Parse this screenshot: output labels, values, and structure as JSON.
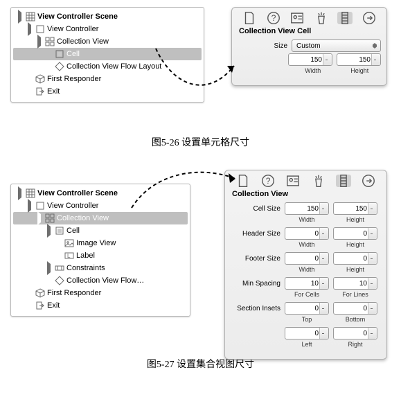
{
  "fig1": {
    "caption": "图5-26   设置单元格尺寸",
    "outline": {
      "rows": [
        {
          "depth": 0,
          "tri": true,
          "icon": "scene",
          "label": "View Controller Scene",
          "bold": true
        },
        {
          "depth": 1,
          "tri": true,
          "icon": "vc",
          "label": "View Controller"
        },
        {
          "depth": 2,
          "tri": true,
          "icon": "collection",
          "label": "Collection View"
        },
        {
          "depth": 3,
          "tri": false,
          "notri": true,
          "icon": "cell",
          "label": "Cell",
          "selected": true
        },
        {
          "depth": 3,
          "tri": false,
          "notri": true,
          "icon": "flow",
          "label": "Collection View Flow Layout"
        },
        {
          "depth": 1,
          "tri": false,
          "notri": true,
          "icon": "cube",
          "label": "First Responder"
        },
        {
          "depth": 1,
          "tri": false,
          "notri": true,
          "icon": "exit",
          "label": "Exit"
        }
      ]
    },
    "inspector": {
      "tabs": [
        "file",
        "help",
        "identity",
        "attrs",
        "size",
        "connections"
      ],
      "activeTab": 4,
      "title": "Collection View Cell",
      "sizeLabel": "Size",
      "sizeValue": "Custom",
      "width": "150",
      "height": "150",
      "widthLabel": "Width",
      "heightLabel": "Height"
    }
  },
  "fig2": {
    "caption": "图5-27   设置集合视图尺寸",
    "outline": {
      "rows": [
        {
          "depth": 0,
          "tri": true,
          "icon": "scene",
          "label": "View Controller Scene",
          "bold": true
        },
        {
          "depth": 1,
          "tri": true,
          "icon": "vc",
          "label": "View Controller"
        },
        {
          "depth": 2,
          "tri": true,
          "icon": "collection",
          "label": "Collection View",
          "selected": true
        },
        {
          "depth": 3,
          "tri": true,
          "icon": "cell",
          "label": "Cell"
        },
        {
          "depth": 4,
          "tri": false,
          "notri": true,
          "icon": "image",
          "label": "Image View"
        },
        {
          "depth": 4,
          "tri": false,
          "notri": true,
          "icon": "label",
          "label": "Label"
        },
        {
          "depth": 3,
          "tri": true,
          "closed": true,
          "icon": "constraints",
          "label": "Constraints"
        },
        {
          "depth": 3,
          "tri": false,
          "notri": true,
          "icon": "flow",
          "label": "Collection View Flow…"
        },
        {
          "depth": 1,
          "tri": false,
          "notri": true,
          "icon": "cube",
          "label": "First Responder"
        },
        {
          "depth": 1,
          "tri": false,
          "notri": true,
          "icon": "exit",
          "label": "Exit"
        }
      ]
    },
    "inspector": {
      "tabs": [
        "file",
        "help",
        "identity",
        "attrs",
        "size",
        "connections"
      ],
      "activeTab": 4,
      "title": "Collection View",
      "groups": [
        {
          "label": "Cell Size",
          "a": "150",
          "b": "150",
          "la": "Width",
          "lb": "Height"
        },
        {
          "label": "Header Size",
          "a": "0",
          "b": "0",
          "la": "Width",
          "lb": "Height"
        },
        {
          "label": "Footer Size",
          "a": "0",
          "b": "0",
          "la": "Width",
          "lb": "Height"
        },
        {
          "label": "Min Spacing",
          "a": "10",
          "b": "10",
          "la": "For Cells",
          "lb": "For Lines"
        },
        {
          "label": "Section Insets",
          "a": "0",
          "b": "0",
          "la": "Top",
          "lb": "Bottom"
        },
        {
          "label": "",
          "a": "0",
          "b": "0",
          "la": "Left",
          "lb": "Right"
        }
      ]
    }
  },
  "icons": {
    "scene": "▦",
    "vc": "◻",
    "collection": "▤",
    "cell": "▢",
    "flow": "◆",
    "cube": "⬢",
    "exit": "⎋",
    "image": "▣",
    "label": "L",
    "constraints": "▭"
  }
}
